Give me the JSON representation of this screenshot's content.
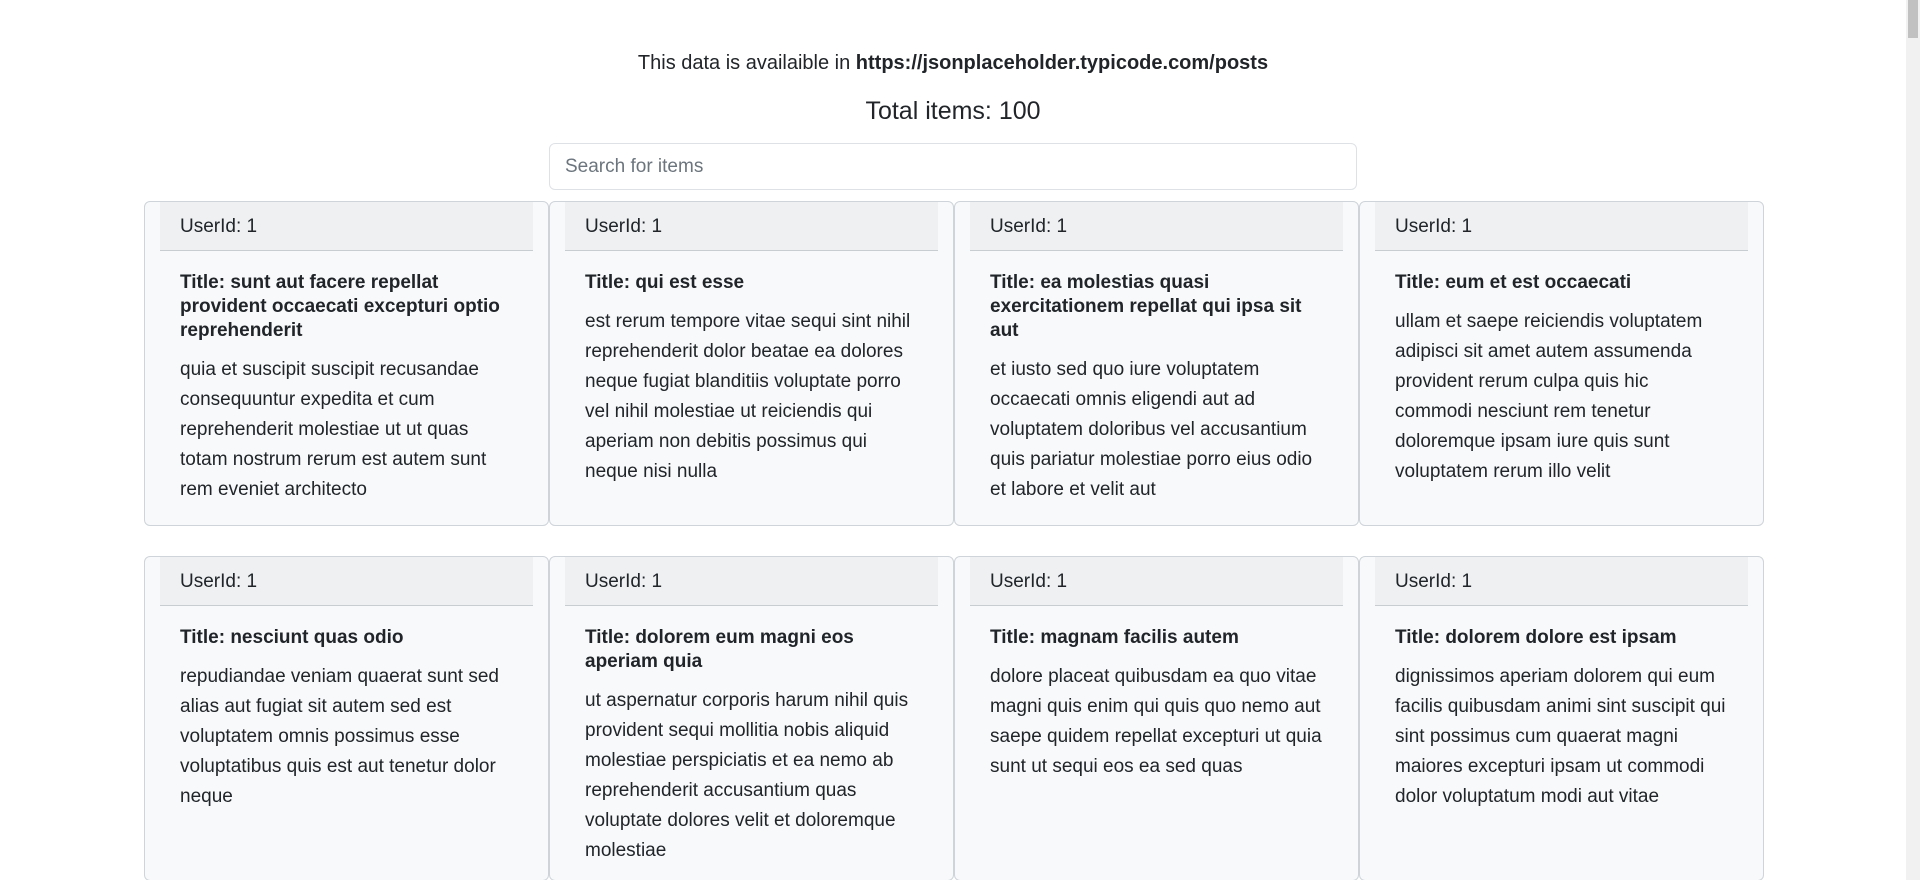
{
  "header": {
    "source_prefix": "This data is availaible in ",
    "source_url": "https://jsonplaceholder.typicode.com/posts",
    "total": "Total items: 100"
  },
  "search": {
    "placeholder": "Search for items",
    "value": ""
  },
  "cards": [
    {
      "user": "UserId: 1",
      "title_label": "Title:",
      "title": "sunt aut facere repellat provident occaecati excepturi optio reprehenderit",
      "body": "quia et suscipit suscipit recusandae consequuntur expedita et cum reprehenderit molestiae ut ut quas totam nostrum rerum est autem sunt rem eveniet architecto"
    },
    {
      "user": "UserId: 1",
      "title_label": "Title:",
      "title": "qui est esse",
      "body": "est rerum tempore vitae sequi sint nihil reprehenderit dolor beatae ea dolores neque fugiat blanditiis voluptate porro vel nihil molestiae ut reiciendis qui aperiam non debitis possimus qui neque nisi nulla"
    },
    {
      "user": "UserId: 1",
      "title_label": "Title:",
      "title": "ea molestias quasi exercitationem repellat qui ipsa sit aut",
      "body": "et iusto sed quo iure voluptatem occaecati omnis eligendi aut ad voluptatem doloribus vel accusantium quis pariatur molestiae porro eius odio et labore et velit aut"
    },
    {
      "user": "UserId: 1",
      "title_label": "Title:",
      "title": "eum et est occaecati",
      "body": "ullam et saepe reiciendis voluptatem adipisci sit amet autem assumenda provident rerum culpa quis hic commodi nesciunt rem tenetur doloremque ipsam iure quis sunt voluptatem rerum illo velit"
    },
    {
      "user": "UserId: 1",
      "title_label": "Title:",
      "title": "nesciunt quas odio",
      "body": "repudiandae veniam quaerat sunt sed alias aut fugiat sit autem sed est voluptatem omnis possimus esse voluptatibus quis est aut tenetur dolor neque"
    },
    {
      "user": "UserId: 1",
      "title_label": "Title:",
      "title": "dolorem eum magni eos aperiam quia",
      "body": "ut aspernatur corporis harum nihil quis provident sequi mollitia nobis aliquid molestiae perspiciatis et ea nemo ab reprehenderit accusantium quas voluptate dolores velit et doloremque molestiae"
    },
    {
      "user": "UserId: 1",
      "title_label": "Title:",
      "title": "magnam facilis autem",
      "body": "dolore placeat quibusdam ea quo vitae magni quis enim qui quis quo nemo aut saepe quidem repellat excepturi ut quia sunt ut sequi eos ea sed quas"
    },
    {
      "user": "UserId: 1",
      "title_label": "Title:",
      "title": "dolorem dolore est ipsam",
      "body": "dignissimos aperiam dolorem qui eum facilis quibusdam animi sint suscipit qui sint possimus cum quaerat magni maiores excepturi ipsam ut commodi dolor voluptatum modi aut vitae"
    }
  ]
}
